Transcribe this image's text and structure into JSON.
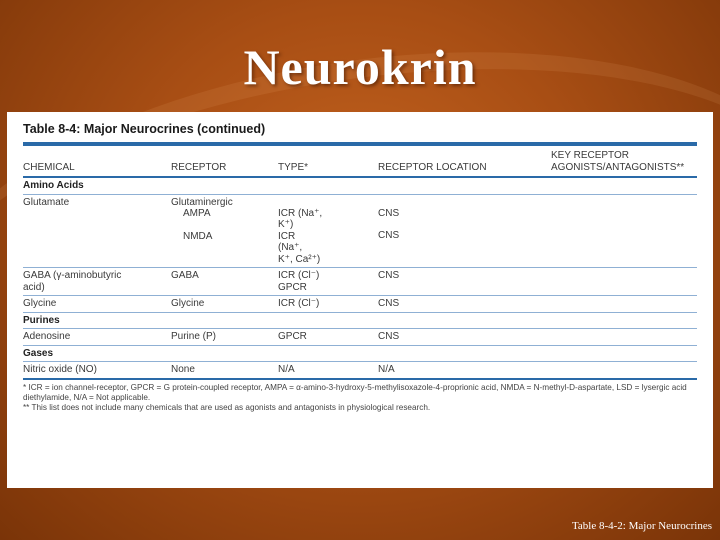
{
  "slide": {
    "title": "Neurokrin",
    "footer_caption": "Table 8-4-2: Major Neurocrines"
  },
  "table": {
    "caption_prefix": "Table 8-4:",
    "caption_title": "Major Neurocrines (continued)",
    "headers": {
      "chemical": "CHEMICAL",
      "receptor": "RECEPTOR",
      "type": "TYPE*",
      "location": "RECEPTOR LOCATION",
      "agonists_line1": "KEY RECEPTOR",
      "agonists_line2": "AGONISTS/ANTAGONISTS**"
    },
    "sections": {
      "amino_acids": "Amino Acids",
      "purines": "Purines",
      "gases": "Gases"
    },
    "rows": {
      "glutamate": {
        "chemical": "Glutamate",
        "receptor": "Glutaminergic",
        "ampa_receptor": "AMPA",
        "ampa_type": "ICR (Na⁺,",
        "ampa_type2": "K⁺)",
        "ampa_location": "CNS",
        "nmda_receptor": "NMDA",
        "nmda_type": "ICR",
        "nmda_type2": "(Na⁺,",
        "nmda_type3": "K⁺, Ca²⁺)",
        "nmda_location": "CNS"
      },
      "gaba": {
        "chemical": "GABA (γ-aminobutyric",
        "chemical2": "acid)",
        "receptor": "GABA",
        "type": "ICR (Cl⁻)",
        "type2": "GPCR",
        "location": "CNS"
      },
      "glycine": {
        "chemical": "Glycine",
        "receptor": "Glycine",
        "type": "ICR (Cl⁻)",
        "location": "CNS"
      },
      "adenosine": {
        "chemical": "Adenosine",
        "receptor": "Purine (P)",
        "type": "GPCR",
        "location": "CNS"
      },
      "nitric_oxide": {
        "chemical": "Nitric oxide (NO)",
        "receptor": "None",
        "type": "N/A",
        "location": "N/A"
      }
    },
    "footnotes": {
      "note1": "* ICR = ion channel-receptor, GPCR = G protein-coupled receptor, AMPA = α-amino-3-hydroxy-5-methylisoxazole-4-proprionic acid, NMDA = N-methyl-D-aspartate, LSD = lysergic acid diethylamide, N/A = Not applicable.",
      "note2": "** This list does not include many chemicals that are used as agonists and antagonists in physiological research."
    }
  }
}
